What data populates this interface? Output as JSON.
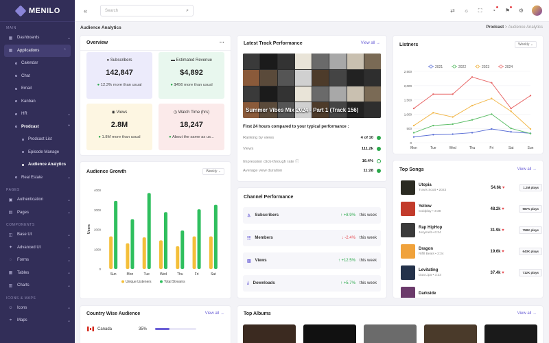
{
  "brand": {
    "name": "MENILO"
  },
  "sidebar": {
    "sections": [
      "MAIN",
      "PAGES",
      "COMPONENTS",
      "ICONS & MAPS"
    ],
    "items": [
      {
        "label": "Dashboards",
        "icon": "dashboard-icon"
      },
      {
        "label": "Applications",
        "icon": "grid-icon"
      },
      {
        "label": "Calendar"
      },
      {
        "label": "Chat"
      },
      {
        "label": "Email"
      },
      {
        "label": "Kanban"
      },
      {
        "label": "HR"
      },
      {
        "label": "Prodcast"
      },
      {
        "label": "Prodcast List"
      },
      {
        "label": "Episode Manage"
      },
      {
        "label": "Audience Analytics"
      },
      {
        "label": "Real Estate"
      },
      {
        "label": "Authentication",
        "icon": "lock-icon"
      },
      {
        "label": "Pages",
        "icon": "file-icon"
      },
      {
        "label": "Base UI",
        "icon": "layers-icon"
      },
      {
        "label": "Advanced UI",
        "icon": "sparkle-icon"
      },
      {
        "label": "Forms",
        "icon": "form-icon"
      },
      {
        "label": "Tables",
        "icon": "table-icon"
      },
      {
        "label": "Charts",
        "icon": "chart-icon"
      },
      {
        "label": "Icons",
        "icon": "smile-icon"
      },
      {
        "label": "Maps",
        "icon": "map-icon"
      }
    ]
  },
  "topbar": {
    "search_placeholder": "Search"
  },
  "page": {
    "title": "Audience Analytics",
    "breadcrumb_root": "Prodcast",
    "breadcrumb_sep": ">",
    "breadcrumb_current": "Audience Analytics"
  },
  "overview": {
    "title": "Overview",
    "more": "···",
    "tiles": [
      {
        "label": "Subscribers",
        "value": "142,847",
        "sub": "12.3% more than usual",
        "color": "#ecebfb"
      },
      {
        "label": "Estimated Revenue",
        "value": "$4,892",
        "sub": "$456 more than usual",
        "color": "#e8f7ee"
      },
      {
        "label": "Views",
        "value": "2.8M",
        "sub": "1.8M more than usual",
        "color": "#fdf6e2"
      },
      {
        "label": "Watch Time (hrs)",
        "value": "18,247",
        "sub": "About the same as us...",
        "color": "#fbeaea"
      }
    ]
  },
  "latest_track": {
    "title": "Latest Track Performance",
    "view_all": "View all →",
    "track_title": "Summer Vibes Mix 2024 - Part 1 (Track 156)",
    "intro": "First 24 hours compared to your typical performance :",
    "rows": [
      {
        "label": "Ranking by views",
        "value": "4 of 10"
      },
      {
        "label": "Views",
        "value": "111.2k"
      },
      {
        "label": "Impression click-through rate ⓘ",
        "value": "16.4%"
      },
      {
        "label": "Average view duration",
        "value": "11:28"
      }
    ]
  },
  "listeners": {
    "title": "Listners",
    "dropdown": "Weekly ⌄",
    "legend": [
      "2021",
      "2022",
      "2023",
      "2024"
    ],
    "colors": [
      "#5b6fd6",
      "#5fbf6a",
      "#f2b84b",
      "#e86a6a"
    ],
    "x": [
      "Mon",
      "Tue",
      "Wed",
      "Thu",
      "Fri",
      "Sat",
      "Sun"
    ],
    "yticks": [
      "0",
      "500",
      "1,000",
      "1,500",
      "2,000",
      "2,500"
    ]
  },
  "audience_growth": {
    "title": "Audience Growth",
    "dropdown": "Weekly ⌄",
    "ylabel": "Users",
    "yticks": [
      "0",
      "1000",
      "2000",
      "3000",
      "4000"
    ],
    "legend": [
      "Unique Listeners",
      "Total Streams"
    ]
  },
  "chart_data": [
    {
      "type": "bar",
      "title": "Audience Growth",
      "ylabel": "Users",
      "ylim": [
        0,
        4000
      ],
      "categories": [
        "Sun",
        "Mon",
        "Tue",
        "Wed",
        "Thu",
        "Fri",
        "Sat"
      ],
      "series": [
        {
          "name": "Unique Listeners",
          "color": "#f4bf3a",
          "values": [
            1650,
            1300,
            1600,
            1450,
            1150,
            1650,
            1650
          ]
        },
        {
          "name": "Total Streams",
          "color": "#2fbf5e",
          "values": [
            3450,
            2520,
            3850,
            2880,
            1950,
            3020,
            3250
          ]
        }
      ],
      "legend_position": "bottom"
    },
    {
      "type": "line",
      "title": "Listners",
      "ylim": [
        0,
        2500
      ],
      "x": [
        "Mon",
        "Tue",
        "Wed",
        "Thu",
        "Fri",
        "Sat",
        "Sun"
      ],
      "series": [
        {
          "name": "2021",
          "color": "#5b6fd6",
          "values": [
            200,
            280,
            300,
            350,
            480,
            380,
            330
          ]
        },
        {
          "name": "2022",
          "color": "#5fbf6a",
          "values": [
            350,
            600,
            650,
            800,
            1000,
            500,
            320
          ]
        },
        {
          "name": "2023",
          "color": "#f2b84b",
          "values": [
            600,
            1050,
            900,
            1300,
            1550,
            1100,
            480
          ]
        },
        {
          "name": "2024",
          "color": "#e86a6a",
          "values": [
            1200,
            1700,
            1700,
            2300,
            2100,
            1200,
            1650
          ]
        }
      ],
      "legend_position": "top"
    }
  ],
  "top_songs": {
    "title": "Top Songs",
    "view_all": "View all →",
    "songs": [
      {
        "title": "Utopia",
        "artist": "Travis Scott • 2023",
        "likes": "54.6k",
        "plays": "1.2M plays",
        "art": "#2b2b22"
      },
      {
        "title": "Yellow",
        "artist": "Coldplay • 3:38",
        "likes": "48.2k",
        "plays": "987K plays",
        "art": "#c23b2b"
      },
      {
        "title": "Rap HipHop",
        "artist": "Josymelt • 6:34",
        "likes": "31.9k",
        "plays": "758K plays",
        "art": "#3a3a3a"
      },
      {
        "title": "Dragon",
        "artist": "Riffil Beats • 2:34",
        "likes": "19.6k",
        "plays": "643K plays",
        "art": "#f0a23b"
      },
      {
        "title": "Levitating",
        "artist": "Dua Lipa • 3:23",
        "likes": "37.4k",
        "plays": "712K plays",
        "art": "#24324a"
      },
      {
        "title": "Darkside",
        "artist": "",
        "likes": "",
        "plays": "",
        "art": "#6b3b6b"
      }
    ]
  },
  "channel": {
    "title": "Channel Performance",
    "period": "this week",
    "rows": [
      {
        "label": "Subscribers",
        "icon": "user-icon",
        "pct": "↑ +8.9%",
        "dir": "up"
      },
      {
        "label": "Members",
        "icon": "users-icon",
        "pct": "↓ -2.4%",
        "dir": "down"
      },
      {
        "label": "Views",
        "icon": "bar-icon",
        "pct": "↑ +12.5%",
        "dir": "up"
      },
      {
        "label": "Downloads",
        "icon": "download-icon",
        "pct": "↑ +5.7%",
        "dir": "up"
      }
    ]
  },
  "country": {
    "title": "Country Wise Audience",
    "view_all": "View all →",
    "rows": [
      {
        "name": "Canada",
        "pct": "35%",
        "fraction": 0.35
      }
    ]
  },
  "albums": {
    "title": "Top Albums",
    "view_all": "View all →",
    "colors": [
      "#3b2a20",
      "#111111",
      "#6b6b6b",
      "#4a3a2a",
      "#1a1a1a"
    ]
  }
}
